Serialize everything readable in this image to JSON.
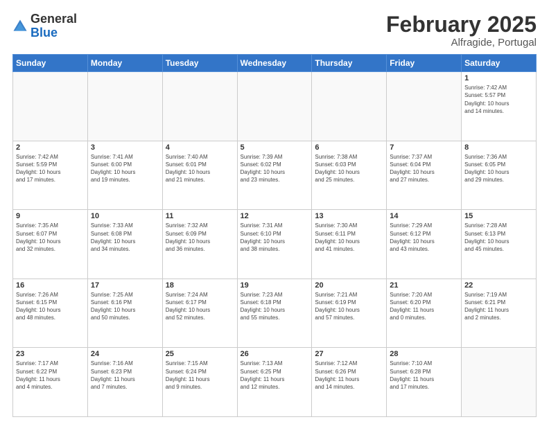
{
  "header": {
    "logo_general": "General",
    "logo_blue": "Blue",
    "title": "February 2025",
    "subtitle": "Alfragide, Portugal"
  },
  "weekdays": [
    "Sunday",
    "Monday",
    "Tuesday",
    "Wednesday",
    "Thursday",
    "Friday",
    "Saturday"
  ],
  "weeks": [
    [
      {
        "day": "",
        "info": ""
      },
      {
        "day": "",
        "info": ""
      },
      {
        "day": "",
        "info": ""
      },
      {
        "day": "",
        "info": ""
      },
      {
        "day": "",
        "info": ""
      },
      {
        "day": "",
        "info": ""
      },
      {
        "day": "1",
        "info": "Sunrise: 7:42 AM\nSunset: 5:57 PM\nDaylight: 10 hours\nand 14 minutes."
      }
    ],
    [
      {
        "day": "2",
        "info": "Sunrise: 7:42 AM\nSunset: 5:59 PM\nDaylight: 10 hours\nand 17 minutes."
      },
      {
        "day": "3",
        "info": "Sunrise: 7:41 AM\nSunset: 6:00 PM\nDaylight: 10 hours\nand 19 minutes."
      },
      {
        "day": "4",
        "info": "Sunrise: 7:40 AM\nSunset: 6:01 PM\nDaylight: 10 hours\nand 21 minutes."
      },
      {
        "day": "5",
        "info": "Sunrise: 7:39 AM\nSunset: 6:02 PM\nDaylight: 10 hours\nand 23 minutes."
      },
      {
        "day": "6",
        "info": "Sunrise: 7:38 AM\nSunset: 6:03 PM\nDaylight: 10 hours\nand 25 minutes."
      },
      {
        "day": "7",
        "info": "Sunrise: 7:37 AM\nSunset: 6:04 PM\nDaylight: 10 hours\nand 27 minutes."
      },
      {
        "day": "8",
        "info": "Sunrise: 7:36 AM\nSunset: 6:05 PM\nDaylight: 10 hours\nand 29 minutes."
      }
    ],
    [
      {
        "day": "9",
        "info": "Sunrise: 7:35 AM\nSunset: 6:07 PM\nDaylight: 10 hours\nand 32 minutes."
      },
      {
        "day": "10",
        "info": "Sunrise: 7:33 AM\nSunset: 6:08 PM\nDaylight: 10 hours\nand 34 minutes."
      },
      {
        "day": "11",
        "info": "Sunrise: 7:32 AM\nSunset: 6:09 PM\nDaylight: 10 hours\nand 36 minutes."
      },
      {
        "day": "12",
        "info": "Sunrise: 7:31 AM\nSunset: 6:10 PM\nDaylight: 10 hours\nand 38 minutes."
      },
      {
        "day": "13",
        "info": "Sunrise: 7:30 AM\nSunset: 6:11 PM\nDaylight: 10 hours\nand 41 minutes."
      },
      {
        "day": "14",
        "info": "Sunrise: 7:29 AM\nSunset: 6:12 PM\nDaylight: 10 hours\nand 43 minutes."
      },
      {
        "day": "15",
        "info": "Sunrise: 7:28 AM\nSunset: 6:13 PM\nDaylight: 10 hours\nand 45 minutes."
      }
    ],
    [
      {
        "day": "16",
        "info": "Sunrise: 7:26 AM\nSunset: 6:15 PM\nDaylight: 10 hours\nand 48 minutes."
      },
      {
        "day": "17",
        "info": "Sunrise: 7:25 AM\nSunset: 6:16 PM\nDaylight: 10 hours\nand 50 minutes."
      },
      {
        "day": "18",
        "info": "Sunrise: 7:24 AM\nSunset: 6:17 PM\nDaylight: 10 hours\nand 52 minutes."
      },
      {
        "day": "19",
        "info": "Sunrise: 7:23 AM\nSunset: 6:18 PM\nDaylight: 10 hours\nand 55 minutes."
      },
      {
        "day": "20",
        "info": "Sunrise: 7:21 AM\nSunset: 6:19 PM\nDaylight: 10 hours\nand 57 minutes."
      },
      {
        "day": "21",
        "info": "Sunrise: 7:20 AM\nSunset: 6:20 PM\nDaylight: 11 hours\nand 0 minutes."
      },
      {
        "day": "22",
        "info": "Sunrise: 7:19 AM\nSunset: 6:21 PM\nDaylight: 11 hours\nand 2 minutes."
      }
    ],
    [
      {
        "day": "23",
        "info": "Sunrise: 7:17 AM\nSunset: 6:22 PM\nDaylight: 11 hours\nand 4 minutes."
      },
      {
        "day": "24",
        "info": "Sunrise: 7:16 AM\nSunset: 6:23 PM\nDaylight: 11 hours\nand 7 minutes."
      },
      {
        "day": "25",
        "info": "Sunrise: 7:15 AM\nSunset: 6:24 PM\nDaylight: 11 hours\nand 9 minutes."
      },
      {
        "day": "26",
        "info": "Sunrise: 7:13 AM\nSunset: 6:25 PM\nDaylight: 11 hours\nand 12 minutes."
      },
      {
        "day": "27",
        "info": "Sunrise: 7:12 AM\nSunset: 6:26 PM\nDaylight: 11 hours\nand 14 minutes."
      },
      {
        "day": "28",
        "info": "Sunrise: 7:10 AM\nSunset: 6:28 PM\nDaylight: 11 hours\nand 17 minutes."
      },
      {
        "day": "",
        "info": ""
      }
    ]
  ]
}
